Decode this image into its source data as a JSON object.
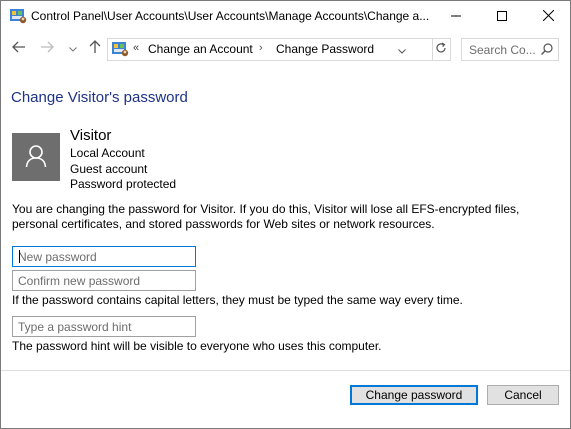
{
  "window": {
    "title": "Control Panel\\User Accounts\\User Accounts\\Manage Accounts\\Change a..."
  },
  "nav": {
    "breadcrumb_chevron": "«",
    "breadcrumb": [
      "Change an Account",
      "Change Password"
    ],
    "breadcrumb_separator": "›",
    "search_placeholder": "Search Co..."
  },
  "page": {
    "heading": "Change Visitor's password"
  },
  "account": {
    "name": "Visitor",
    "type": "Local Account",
    "role": "Guest account",
    "status": "Password protected"
  },
  "info": "You are changing the password for Visitor.  If you do this, Visitor will lose all EFS-encrypted files, personal certificates, and stored passwords for Web sites or network resources.",
  "form": {
    "new_password_placeholder": "New password",
    "new_password_value": "",
    "confirm_placeholder": "Confirm new password",
    "confirm_value": "",
    "case_note": "If the password contains capital letters, they must be typed the same way every time.",
    "hint_placeholder": "Type a password hint",
    "hint_value": "",
    "hint_note": "The password hint will be visible to everyone who uses this computer."
  },
  "buttons": {
    "change_password": "Change password",
    "cancel": "Cancel"
  },
  "colors": {
    "heading": "#1e3287",
    "focus_border": "#0078d7",
    "avatar_bg": "#6e6e6e"
  },
  "icons": [
    "control-panel-icon",
    "minimize-icon",
    "maximize-icon",
    "close-icon",
    "back-arrow-icon",
    "forward-arrow-icon",
    "chevron-down-icon",
    "up-arrow-icon",
    "refresh-icon",
    "search-icon",
    "user-avatar-icon"
  ]
}
